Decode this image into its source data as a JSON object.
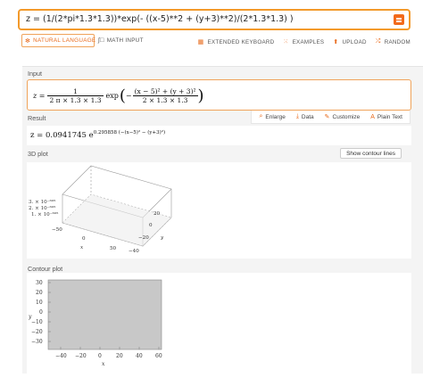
{
  "query": {
    "text": "z = (1/(2*pi*1.3*1.3))*exp(- ((x-5)**2 + (y+3)**2)/(2*1.3*1.3) )"
  },
  "modes": {
    "natural_language": "NATURAL LANGUAGE",
    "math_input": "MATH INPUT"
  },
  "tools": {
    "extended_keyboard": "EXTENDED KEYBOARD",
    "examples": "EXAMPLES",
    "upload": "UPLOAD",
    "random": "RANDOM"
  },
  "pods": {
    "input_title": "Input",
    "result_title": "Result",
    "plot3d_title": "3D plot",
    "contour_title": "Contour plot"
  },
  "input_math": {
    "lhs": "z =",
    "num": "1",
    "den": "2 π × 1.3 × 1.3",
    "exp": "exp",
    "inner_num": "(x − 5)² + (y + 3)²",
    "inner_den": "2 × 1.3 × 1.3"
  },
  "result_actions": {
    "enlarge": "Enlarge",
    "data": "Data",
    "customize": "Customize",
    "plain_text": "Plain Text"
  },
  "result_math": {
    "lhs": "z = 0.0941745 e",
    "exponent": "0.295858 (−(x−5)² − (y+3)²)"
  },
  "show_contour_lines": "Show contour lines",
  "plot3d": {
    "z_ticks": [
      "3. × 10⁻⁶⁰⁵",
      "2. × 10⁻⁶⁰⁵",
      "1. × 10⁻⁶⁰⁵"
    ],
    "x_ticks": [
      "−50",
      "0",
      "50"
    ],
    "y_ticks": [
      "20",
      "0",
      "−20",
      "−40"
    ],
    "xlabel": "x",
    "ylabel": "y"
  },
  "contour": {
    "y_ticks": [
      "30",
      "20",
      "10",
      "0",
      "−10",
      "−20",
      "−30"
    ],
    "x_ticks": [
      "−40",
      "−20",
      "0",
      "20",
      "40",
      "60"
    ],
    "xlabel": "x",
    "ylabel": "y"
  },
  "colors": {
    "accent": "#f26a1b",
    "border": "#f39a2b",
    "panel": "#f4f4f4",
    "contour_fill": "#c8c8c8"
  }
}
